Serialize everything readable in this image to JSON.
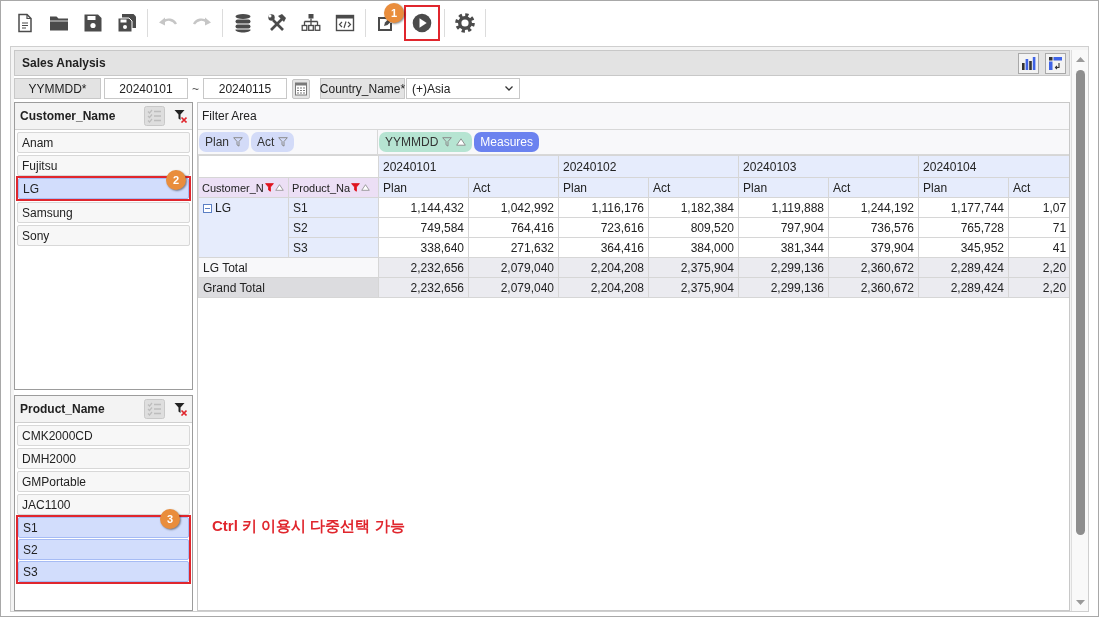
{
  "toolbar": {
    "groups": [
      [
        {
          "kind": "new",
          "disabled": false
        },
        {
          "kind": "open",
          "disabled": false
        },
        {
          "kind": "save",
          "disabled": false
        },
        {
          "kind": "save_all",
          "disabled": false
        }
      ],
      [
        {
          "kind": "undo",
          "disabled": true
        },
        {
          "kind": "redo",
          "disabled": true
        }
      ],
      [
        {
          "kind": "data",
          "disabled": false
        },
        {
          "kind": "tools",
          "disabled": false
        },
        {
          "kind": "hierarchy",
          "disabled": false
        },
        {
          "kind": "script",
          "disabled": false
        }
      ],
      [
        {
          "kind": "edit",
          "disabled": false
        },
        {
          "kind": "run",
          "disabled": false,
          "callout": "1"
        }
      ],
      [
        {
          "kind": "settings",
          "disabled": false
        }
      ]
    ]
  },
  "report": {
    "title": "Sales Analysis"
  },
  "conditions": [
    {
      "kind": "date_range",
      "label": "YYMMDD*",
      "from": "20240101",
      "separator": "~",
      "to": "20240115"
    },
    {
      "kind": "select",
      "label": "Country_Name*",
      "value": "(+)Asia"
    }
  ],
  "customer_filter": {
    "title": "Customer_Name",
    "items": [
      {
        "label": "Anam",
        "selected": false
      },
      {
        "label": "Fujitsu",
        "selected": false
      },
      {
        "label": "LG",
        "selected": true,
        "callout": "2"
      },
      {
        "label": "Samsung",
        "selected": false
      },
      {
        "label": "Sony",
        "selected": false
      }
    ]
  },
  "product_filter": {
    "title": "Product_Name",
    "items": [
      {
        "label": "CMK2000CD",
        "selected": false
      },
      {
        "label": "DMH2000",
        "selected": false
      },
      {
        "label": "GMPortable",
        "selected": false
      },
      {
        "label": "JAC1100",
        "selected": false
      },
      {
        "label": "S1",
        "selected": true
      },
      {
        "label": "S2",
        "selected": true
      },
      {
        "label": "S3",
        "selected": true
      }
    ],
    "callout": {
      "badge": "3",
      "note": "Ctrl 키 이용시 다중선택 가능"
    }
  },
  "pivot": {
    "filter_area": "Filter Area",
    "data_fields": [
      {
        "label": "Plan"
      },
      {
        "label": "Act"
      }
    ],
    "column_fields": [
      {
        "kind": "dimension",
        "label": "YYMMDD"
      },
      {
        "kind": "measures",
        "label": "Measures"
      }
    ],
    "row_fields": [
      {
        "label": "Customer_N",
        "filtered": true
      },
      {
        "label": "Product_Na",
        "filtered": true
      }
    ],
    "dates": [
      "20240101",
      "20240102",
      "20240103",
      "20240104"
    ],
    "measures": [
      "Plan",
      "Act",
      "Plan",
      "Act",
      "Plan",
      "Act",
      "Plan",
      "Act"
    ],
    "groups": [
      {
        "label": "LG",
        "expanded": true,
        "rows": [
          {
            "label": "S1",
            "values": [
              "1,144,432",
              "1,042,992",
              "1,116,176",
              "1,182,384",
              "1,119,888",
              "1,244,192",
              "1,177,744",
              "1,07"
            ]
          },
          {
            "label": "S2",
            "values": [
              "749,584",
              "764,416",
              "723,616",
              "809,520",
              "797,904",
              "736,576",
              "765,728",
              "71"
            ]
          },
          {
            "label": "S3",
            "values": [
              "338,640",
              "271,632",
              "364,416",
              "384,000",
              "381,344",
              "379,904",
              "345,952",
              "41"
            ]
          }
        ]
      }
    ],
    "totals": [
      {
        "kind": "subtotal",
        "label": "LG Total",
        "values": [
          "2,232,656",
          "2,079,040",
          "2,204,208",
          "2,375,904",
          "2,299,136",
          "2,360,672",
          "2,289,424",
          "2,20"
        ]
      },
      {
        "kind": "grand",
        "label": "Grand Total",
        "values": [
          "2,232,656",
          "2,079,040",
          "2,204,208",
          "2,375,904",
          "2,299,136",
          "2,360,672",
          "2,289,424",
          "2,20"
        ]
      }
    ]
  }
}
